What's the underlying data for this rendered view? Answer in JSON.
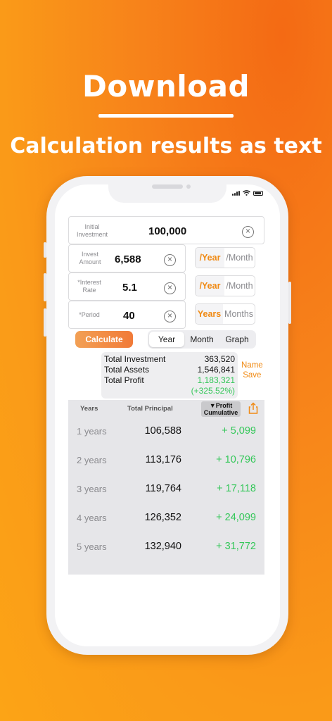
{
  "banner": {
    "title": "Download",
    "subtitle": "Calculation results as text"
  },
  "form": {
    "initial_investment": {
      "label": "Initial Investment",
      "value": "100,000"
    },
    "invest_amount": {
      "label": "Invest Amount",
      "value": "6,588"
    },
    "interest_rate": {
      "label": "*Interest Rate",
      "value": "5.1"
    },
    "period": {
      "label": "*Period",
      "value": "40"
    },
    "amount_unit": {
      "selected": "/Year",
      "other": "/Month"
    },
    "rate_unit": {
      "selected": "/Year",
      "other": "/Month"
    },
    "period_unit": {
      "selected": "Years",
      "other": "Months"
    }
  },
  "actions": {
    "calculate": "Calculate",
    "tabs": [
      "Year",
      "Month",
      "Graph"
    ],
    "selected_tab": "Year"
  },
  "summary": {
    "total_investment_label": "Total Investment",
    "total_investment": "363,520",
    "total_assets_label": "Total Assets",
    "total_assets": "1,546,841",
    "total_profit_label": "Total Profit",
    "total_profit": "1,183,321",
    "total_profit_pct": "(+325.52%)",
    "name_save_1": "Name",
    "name_save_2": "Save"
  },
  "table": {
    "col_years": "Years",
    "col_principal": "Total Principal",
    "col_profit_1": "▼Profit",
    "col_profit_2": "Cumulative",
    "rows": [
      {
        "year": "1 years",
        "principal": "106,588",
        "profit": "+ 5,099"
      },
      {
        "year": "2 years",
        "principal": "113,176",
        "profit": "+ 10,796"
      },
      {
        "year": "3 years",
        "principal": "119,764",
        "profit": "+ 17,118"
      },
      {
        "year": "4 years",
        "principal": "126,352",
        "profit": "+ 24,099"
      },
      {
        "year": "5 years",
        "principal": "132,940",
        "profit": "+ 31,772"
      }
    ]
  },
  "colors": {
    "accent": "#f08a14",
    "profit_green": "#34c759",
    "background": "#f7821a"
  }
}
